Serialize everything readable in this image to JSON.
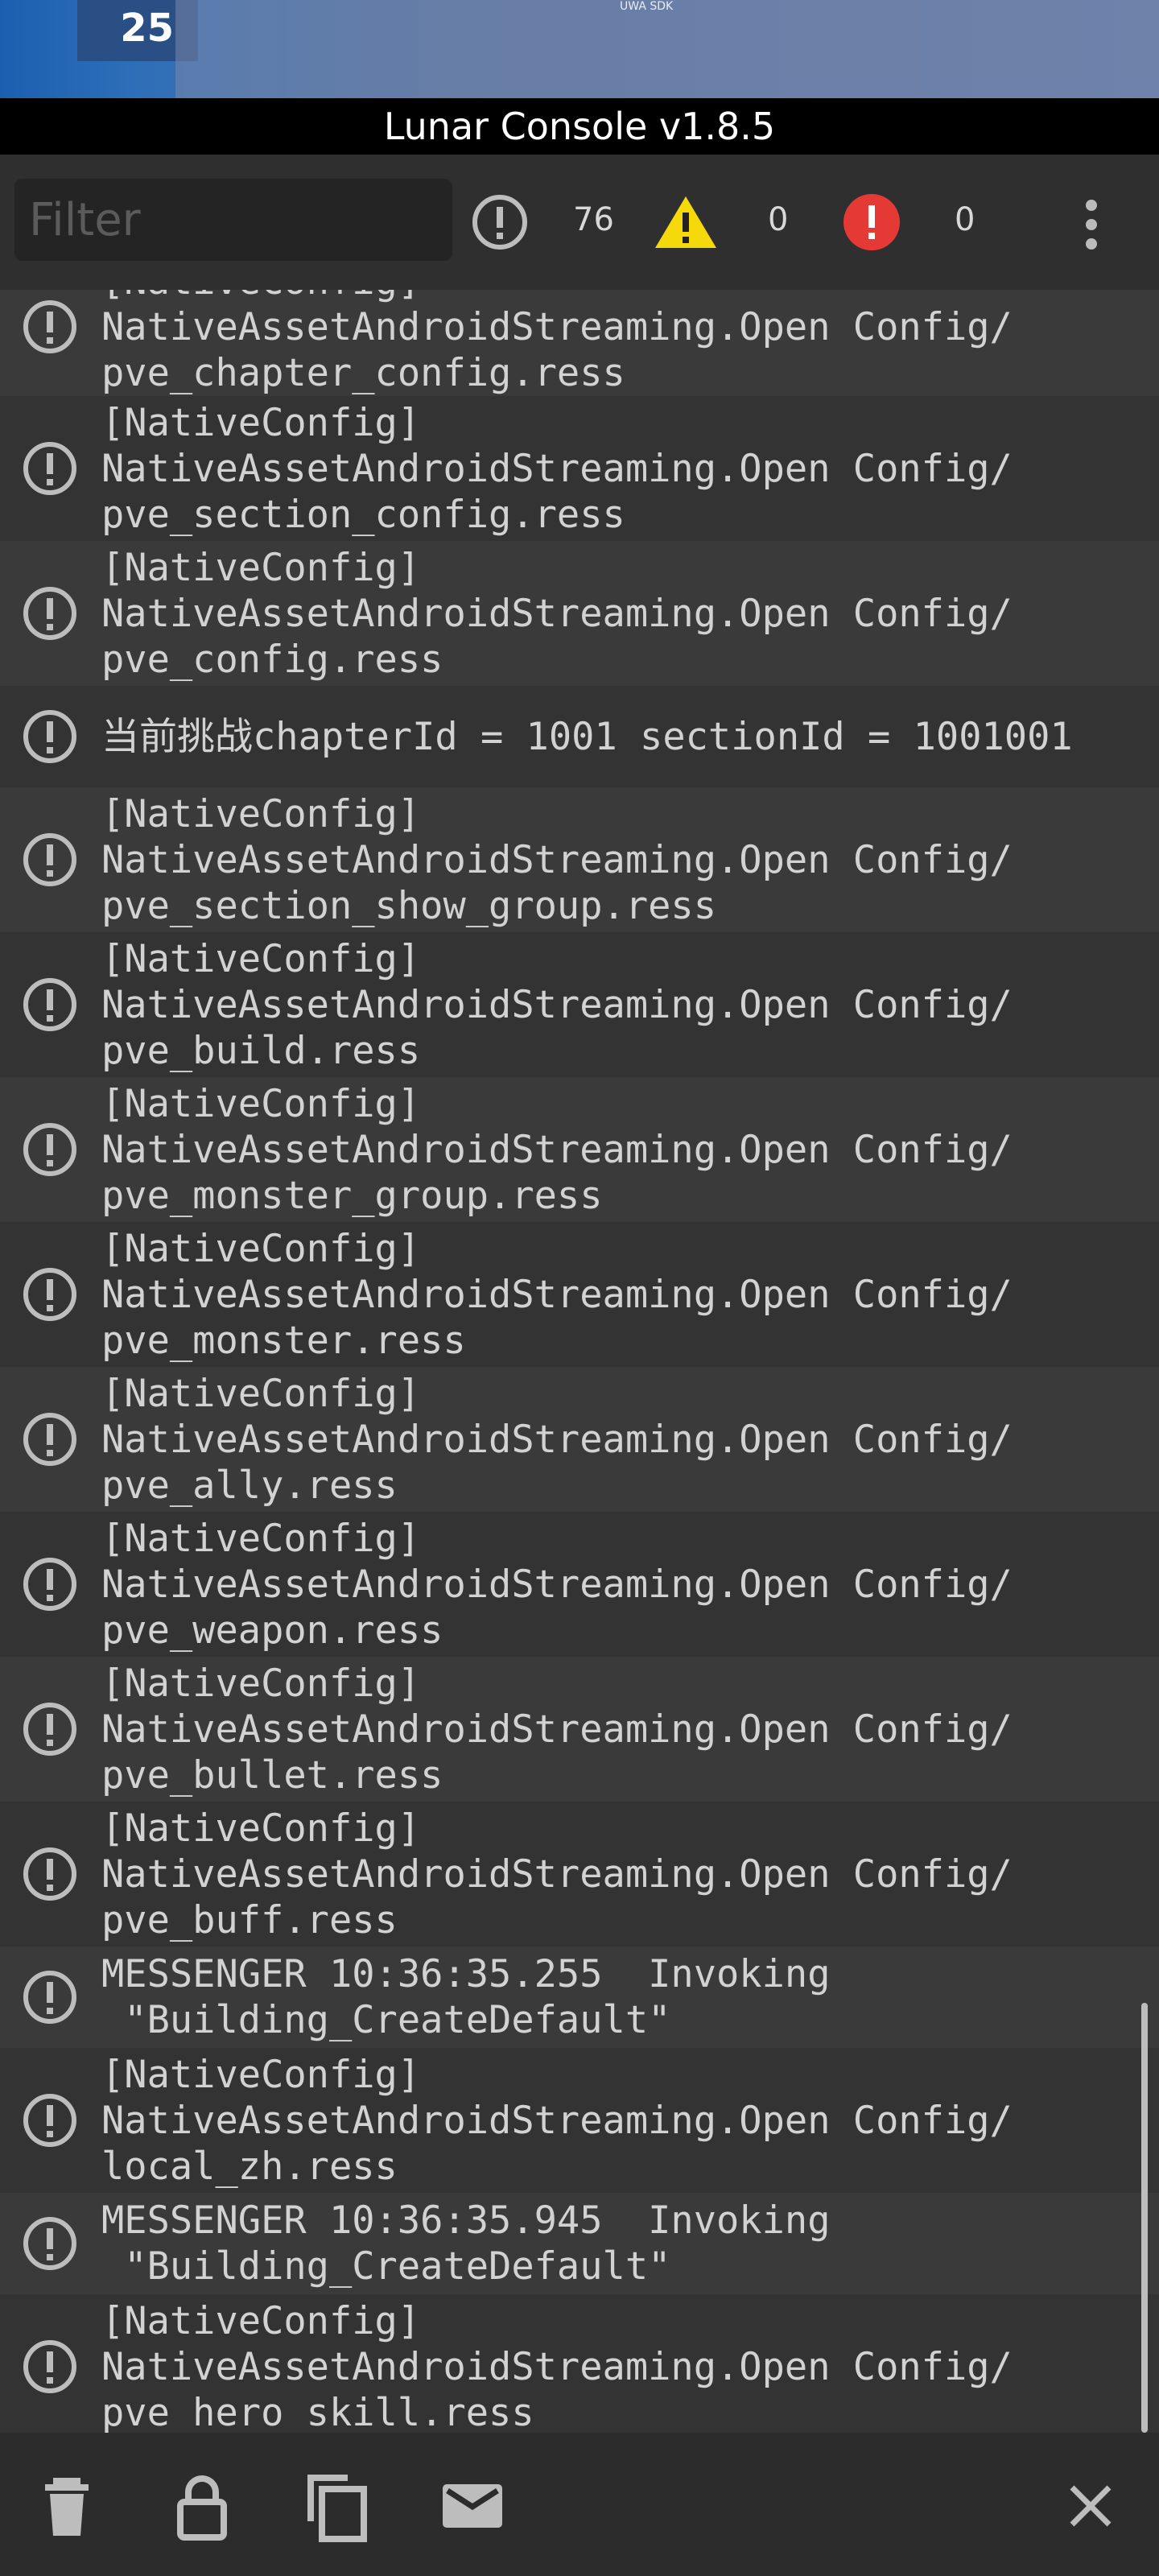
{
  "top_strip": {
    "level": "25",
    "sdk_label": "UWA SDK"
  },
  "title": "Lunar Console v1.8.5",
  "toolbar": {
    "filter_placeholder": "Filter",
    "log_count": "76",
    "warning_count": "0",
    "error_count": "0"
  },
  "colors": {
    "background": "#3a3a3a",
    "row_alt": "#333333",
    "title_bar": "#000000",
    "warning_yellow": "#f5d90a",
    "error_red": "#e53935",
    "text": "#d2d2d2"
  },
  "log_entries": [
    {
      "text": "[NativeConfig]\nNativeAssetAndroidStreaming.Open Config/\npve_chapter_config.ress"
    },
    {
      "text": "[NativeConfig]\nNativeAssetAndroidStreaming.Open Config/\npve_section_config.ress"
    },
    {
      "text": "[NativeConfig]\nNativeAssetAndroidStreaming.Open Config/\npve_config.ress"
    },
    {
      "text": "当前挑战chapterId = 1001 sectionId = 1001001"
    },
    {
      "text": "[NativeConfig]\nNativeAssetAndroidStreaming.Open Config/\npve_section_show_group.ress"
    },
    {
      "text": "[NativeConfig]\nNativeAssetAndroidStreaming.Open Config/\npve_build.ress"
    },
    {
      "text": "[NativeConfig]\nNativeAssetAndroidStreaming.Open Config/\npve_monster_group.ress"
    },
    {
      "text": "[NativeConfig]\nNativeAssetAndroidStreaming.Open Config/\npve_monster.ress"
    },
    {
      "text": "[NativeConfig]\nNativeAssetAndroidStreaming.Open Config/\npve_ally.ress"
    },
    {
      "text": "[NativeConfig]\nNativeAssetAndroidStreaming.Open Config/\npve_weapon.ress"
    },
    {
      "text": "[NativeConfig]\nNativeAssetAndroidStreaming.Open Config/\npve_bullet.ress"
    },
    {
      "text": "[NativeConfig]\nNativeAssetAndroidStreaming.Open Config/\npve_buff.ress"
    },
    {
      "text": "MESSENGER 10:36:35.255  Invoking\n \"Building_CreateDefault\""
    },
    {
      "text": "[NativeConfig]\nNativeAssetAndroidStreaming.Open Config/\nlocal_zh.ress"
    },
    {
      "text": "MESSENGER 10:36:35.945  Invoking\n \"Building_CreateDefault\""
    },
    {
      "text": "[NativeConfig]\nNativeAssetAndroidStreaming.Open Config/\npve_hero_skill.ress"
    }
  ],
  "bottom_bar": {
    "icons": [
      "trash-icon",
      "lock-icon",
      "copy-icon",
      "email-icon",
      "close-icon"
    ]
  }
}
